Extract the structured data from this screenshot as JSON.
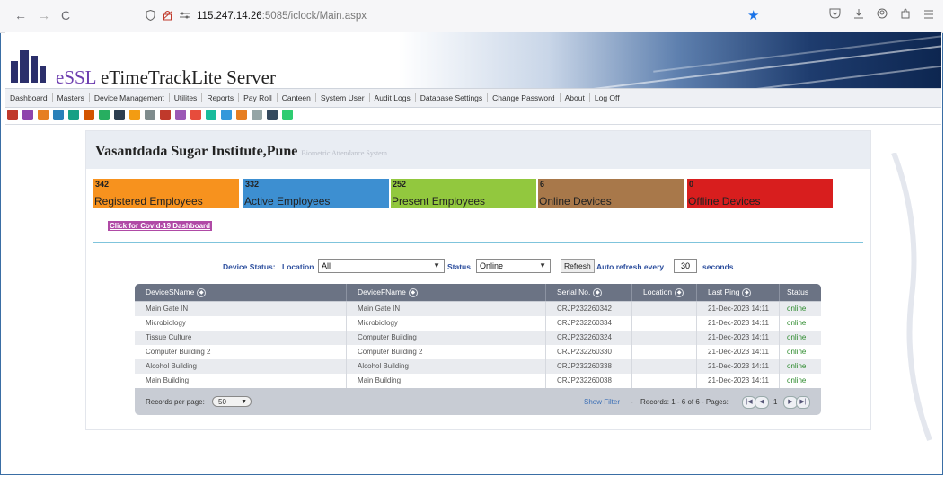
{
  "browser": {
    "back": "←",
    "forward": "→",
    "reload": "C",
    "url_host": "115.247.14.26",
    "url_rest": ":5085/iclock/Main.aspx"
  },
  "app": {
    "brand_prefix": "eSSL",
    "brand_rest": " eTimeTrackLite Server"
  },
  "menu": [
    "Dashboard",
    "Masters",
    "Device Management",
    "Utilites",
    "Reports",
    "Pay Roll",
    "Canteen",
    "System User",
    "Audit Logs",
    "Database Settings",
    "Change Password",
    "About",
    "Log Off"
  ],
  "toolbar_icon_colors": [
    "#c0392b",
    "#8e44ad",
    "#e67e22",
    "#2980b9",
    "#16a085",
    "#d35400",
    "#27ae60",
    "#2c3e50",
    "#f39c12",
    "#7f8c8d",
    "#c0392b",
    "#9b59b6",
    "#e74c3c",
    "#1abc9c",
    "#3498db",
    "#e67e22",
    "#95a5a6",
    "#34495e",
    "#2ecc71"
  ],
  "org": {
    "name": "Vasantdada Sugar Institute,Pune",
    "subtitle": "Biometric Attendance System"
  },
  "stats": [
    {
      "value": "342",
      "label": "Registered Employees",
      "color": "#f7921e"
    },
    {
      "value": "332",
      "label": "Active Employees",
      "color": "#3d8fd1"
    },
    {
      "value": "252",
      "label": "Present Employees",
      "color": "#92c83e"
    },
    {
      "value": "6",
      "label": "Online Devices",
      "color": "#a8784a"
    },
    {
      "value": "0",
      "label": "Offline Devices",
      "color": "#d81e1e"
    }
  ],
  "covid_link": "Click for Covid-19 Dashboard",
  "filters": {
    "device_status_label": "Device Status:",
    "location_label": "Location",
    "location_value": "All",
    "status_label": "Status",
    "status_value": "Online",
    "refresh_button": "Refresh",
    "auto_refresh_label": "Auto refresh every",
    "auto_refresh_value": "30",
    "seconds_label": "seconds"
  },
  "grid": {
    "columns": [
      "DeviceSName",
      "DeviceFName",
      "Serial No.",
      "Location",
      "Last Ping",
      "Status"
    ],
    "rows": [
      [
        "Main Gate IN",
        "Main Gate IN",
        "CRJP232260342",
        "",
        "21-Dec-2023 14:11",
        "online"
      ],
      [
        "Microbiology",
        "Microbiology",
        "CRJP232260334",
        "",
        "21-Dec-2023 14:11",
        "online"
      ],
      [
        "Tissue Culture",
        "Computer Building",
        "CRJP232260324",
        "",
        "21-Dec-2023 14:11",
        "online"
      ],
      [
        "Computer Building 2",
        "Computer Building 2",
        "CRJP232260330",
        "",
        "21-Dec-2023 14:11",
        "online"
      ],
      [
        "Alcohol Building",
        "Alcohol Building",
        "CRJP232260338",
        "",
        "21-Dec-2023 14:11",
        "online"
      ],
      [
        "Main Building",
        "Main Building",
        "CRJP232260038",
        "",
        "21-Dec-2023 14:11",
        "online"
      ]
    ],
    "footer": {
      "records_per_page_label": "Records per page:",
      "records_per_page_value": "50",
      "show_filter": "Show Filter",
      "records_info": "Records: 1 - 6 of 6 - Pages:",
      "page_number": "1"
    }
  }
}
